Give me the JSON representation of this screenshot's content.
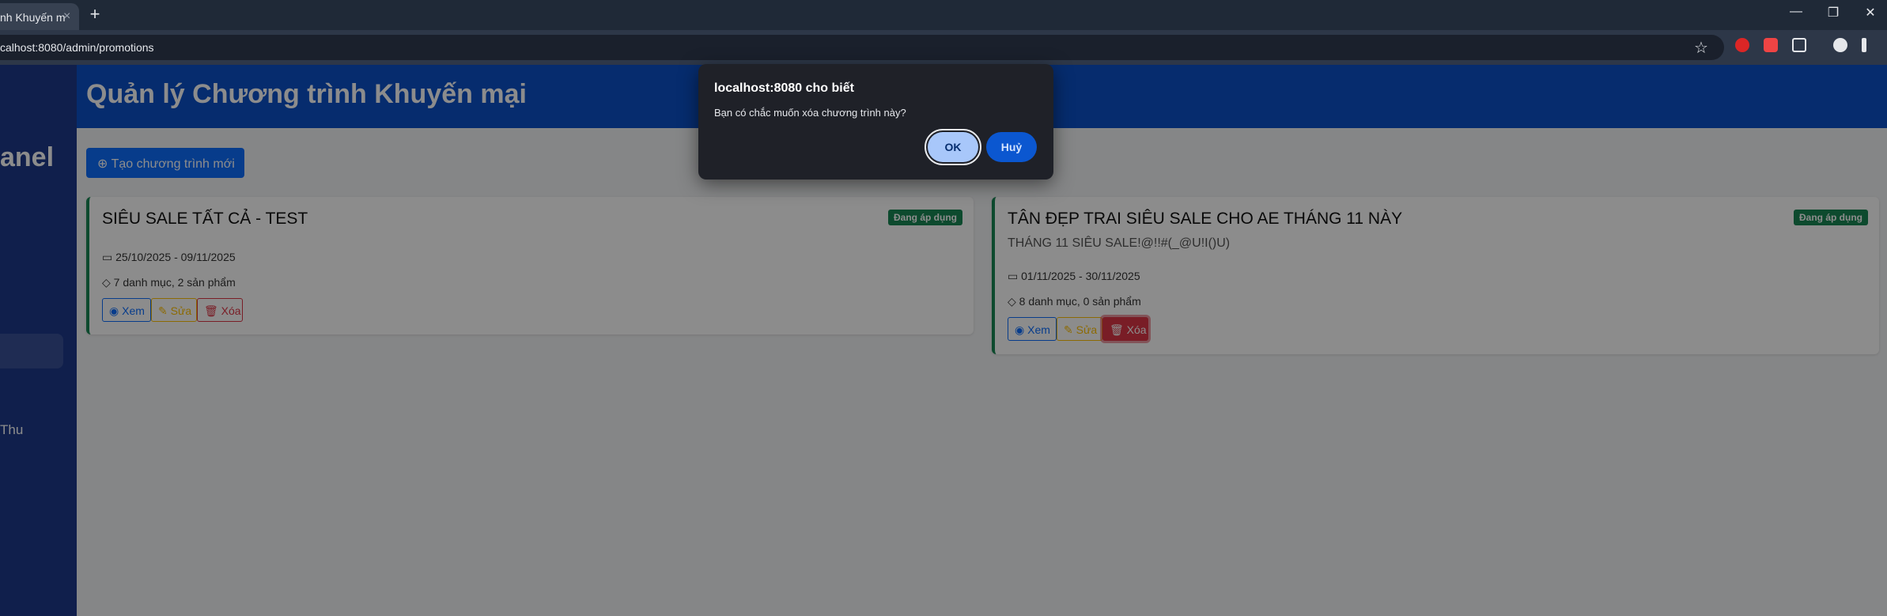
{
  "browser": {
    "tab_title": "nh Khuyến m",
    "tab_close": "×",
    "new_tab": "+",
    "url": "calhost:8080/admin/promotions",
    "window_controls": {
      "minimize": "—",
      "restore": "❐",
      "close": "✕"
    },
    "bookmark_icon": "☆"
  },
  "sidebar": {
    "brand": "anel",
    "item_thu": "Thu"
  },
  "header": {
    "title": "Quản lý Chương trình Khuyến mại"
  },
  "actions": {
    "create_label": "⊕ Tạo chương trình mới"
  },
  "promotions": [
    {
      "title": "SIÊU SALE TẤT CẢ - TEST",
      "subtitle": "",
      "status": "Đang áp dụng",
      "dates": "25/10/2025 - 09/11/2025",
      "scope": "7 danh mục, 2 sản phẩm",
      "view_label": "Xem",
      "edit_label": "Sửa",
      "delete_label": "Xóa"
    },
    {
      "title": "TÂN ĐẸP TRAI SIÊU SALE CHO AE THÁNG 11 NÀY",
      "subtitle": "THÁNG 11 SIÊU SALE!@!!#(_@U!I()U)",
      "status": "Đang áp dụng",
      "dates": "01/11/2025 - 30/11/2025",
      "scope": "8 danh mục, 0 sản phẩm",
      "view_label": "Xem",
      "edit_label": "Sửa",
      "delete_label": "Xóa"
    }
  ],
  "dialog": {
    "title": "localhost:8080 cho biết",
    "message": "Bạn có chắc muốn xóa chương trình này?",
    "ok_label": "OK",
    "cancel_label": "Huỷ"
  },
  "colors": {
    "header": "#0b50c9",
    "sidebar": "#1e3a8a",
    "active_badge": "#198754",
    "dialog_bg": "#1f2128"
  }
}
